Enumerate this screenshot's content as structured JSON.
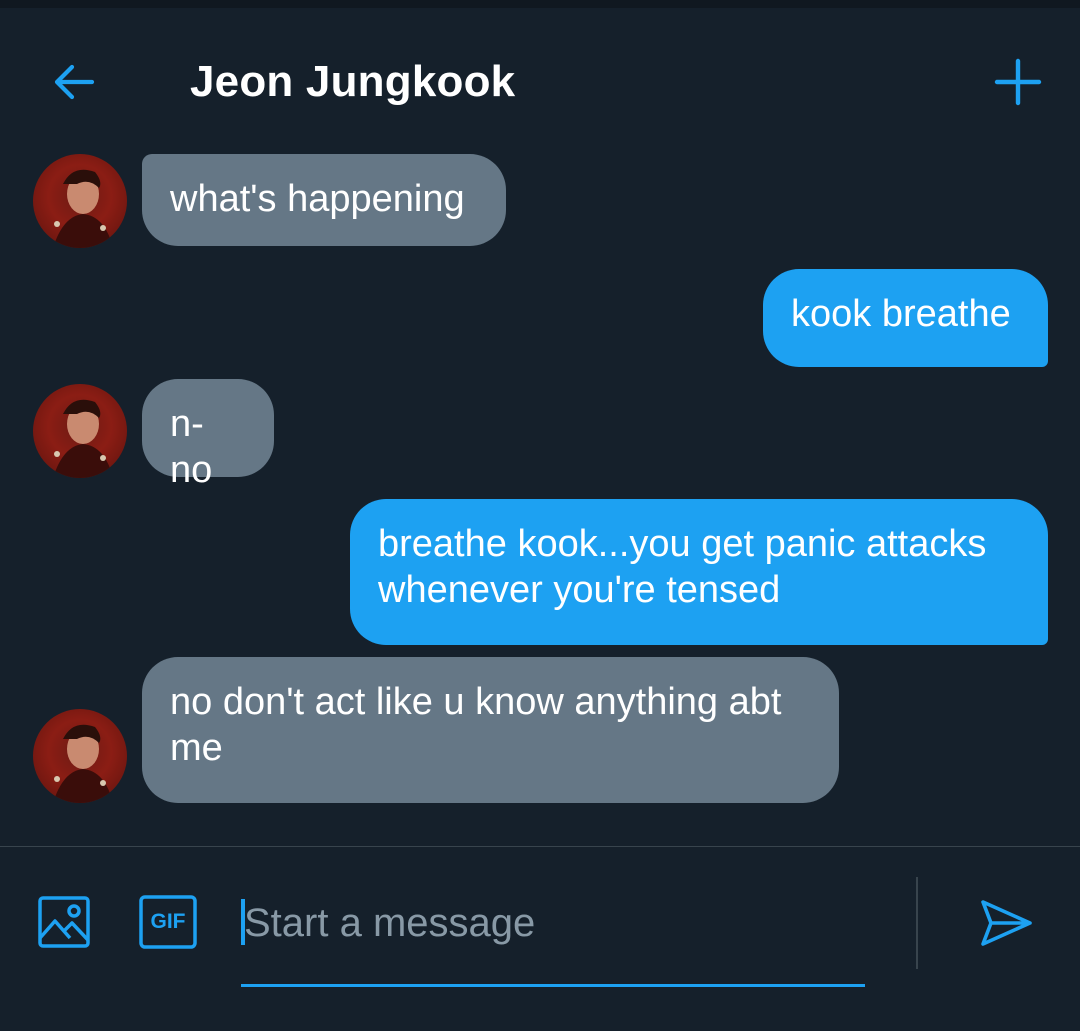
{
  "header": {
    "title": "Jeon Jungkook",
    "back_icon": "arrow-left-icon",
    "new_icon": "plus-icon"
  },
  "messages": [
    {
      "direction": "incoming",
      "text": "what's happening"
    },
    {
      "direction": "outgoing",
      "text": "kook breathe"
    },
    {
      "direction": "incoming",
      "text": "n-no"
    },
    {
      "direction": "outgoing",
      "text": "breathe kook...you get panic attacks whenever you're tensed"
    },
    {
      "direction": "incoming",
      "text": "no don't act like u know anything abt me"
    }
  ],
  "composer": {
    "placeholder": "Start a message",
    "value": "",
    "image_icon": "image-icon",
    "gif_label": "GIF",
    "send_icon": "send-icon"
  },
  "colors": {
    "background": "#15202b",
    "accent": "#1da1f2",
    "incoming_bubble": "#657786",
    "divider": "#38444d",
    "placeholder": "#8899a6"
  }
}
